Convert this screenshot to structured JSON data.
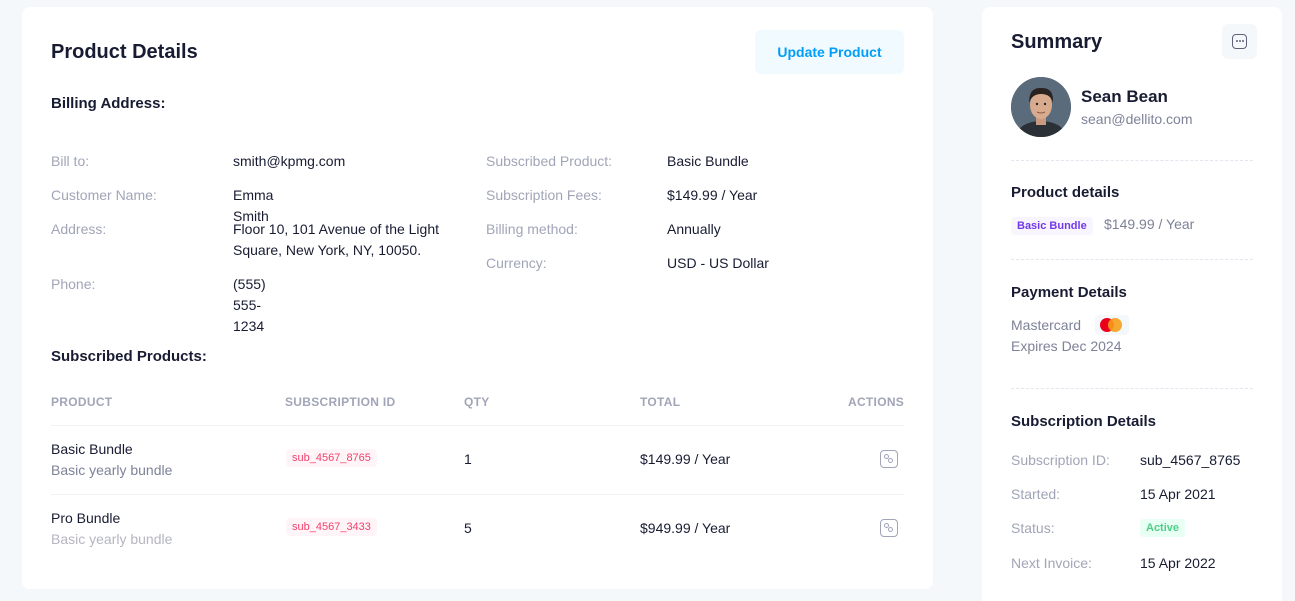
{
  "product_details": {
    "title": "Product Details",
    "update_button": "Update Product",
    "billing_section_title": "Billing Address:",
    "billing_left": [
      {
        "label": "Bill to:",
        "value": "smith@kpmg.com"
      },
      {
        "label": "Customer Name:",
        "value": "Emma Smith"
      },
      {
        "label": "Address:",
        "value": "Floor 10, 101 Avenue of the Light Square, New York, NY, 10050."
      },
      {
        "label": "Phone:",
        "value": "(555) 555-1234"
      }
    ],
    "billing_right": [
      {
        "label": "Subscribed Product:",
        "value": "Basic Bundle"
      },
      {
        "label": "Subscription Fees:",
        "value": "$149.99 / Year"
      },
      {
        "label": "Billing method:",
        "value": "Annually"
      },
      {
        "label": "Currency:",
        "value": "USD - US Dollar"
      }
    ],
    "subscribed_section_title": "Subscribed Products:",
    "table": {
      "headers": [
        "PRODUCT",
        "SUBSCRIPTION ID",
        "QTY",
        "TOTAL",
        "ACTIONS"
      ],
      "rows": [
        {
          "name": "Basic Bundle",
          "desc": "Basic yearly bundle",
          "sub_id": "sub_4567_8765",
          "qty": "1",
          "total": "$149.99 / Year"
        },
        {
          "name": "Pro Bundle",
          "desc": "Basic yearly bundle",
          "sub_id": "sub_4567_3433",
          "qty": "5",
          "total": "$949.99 / Year"
        }
      ]
    }
  },
  "summary": {
    "title": "Summary",
    "user": {
      "name": "Sean Bean",
      "email": "sean@dellito.com"
    },
    "product_details": {
      "title": "Product details",
      "badge": "Basic Bundle",
      "price": "$149.99 / Year"
    },
    "payment_details": {
      "title": "Payment Details",
      "card": "Mastercard",
      "expires": "Expires Dec 2024"
    },
    "subscription_details": {
      "title": "Subscription Details",
      "items": [
        {
          "label": "Subscription ID:",
          "value": "sub_4567_8765"
        },
        {
          "label": "Started:",
          "value": "15 Apr 2021"
        },
        {
          "label": "Status:",
          "value": "Active"
        },
        {
          "label": "Next Invoice:",
          "value": "15 Apr 2022"
        }
      ]
    }
  },
  "colors": {
    "primary": "#009ef7",
    "danger_badge": "#f1416c",
    "purple_badge": "#7239ea",
    "success_badge": "#50cd89"
  },
  "icons": [
    "more-icon",
    "mastercard-icon",
    "settings-action-icon"
  ]
}
